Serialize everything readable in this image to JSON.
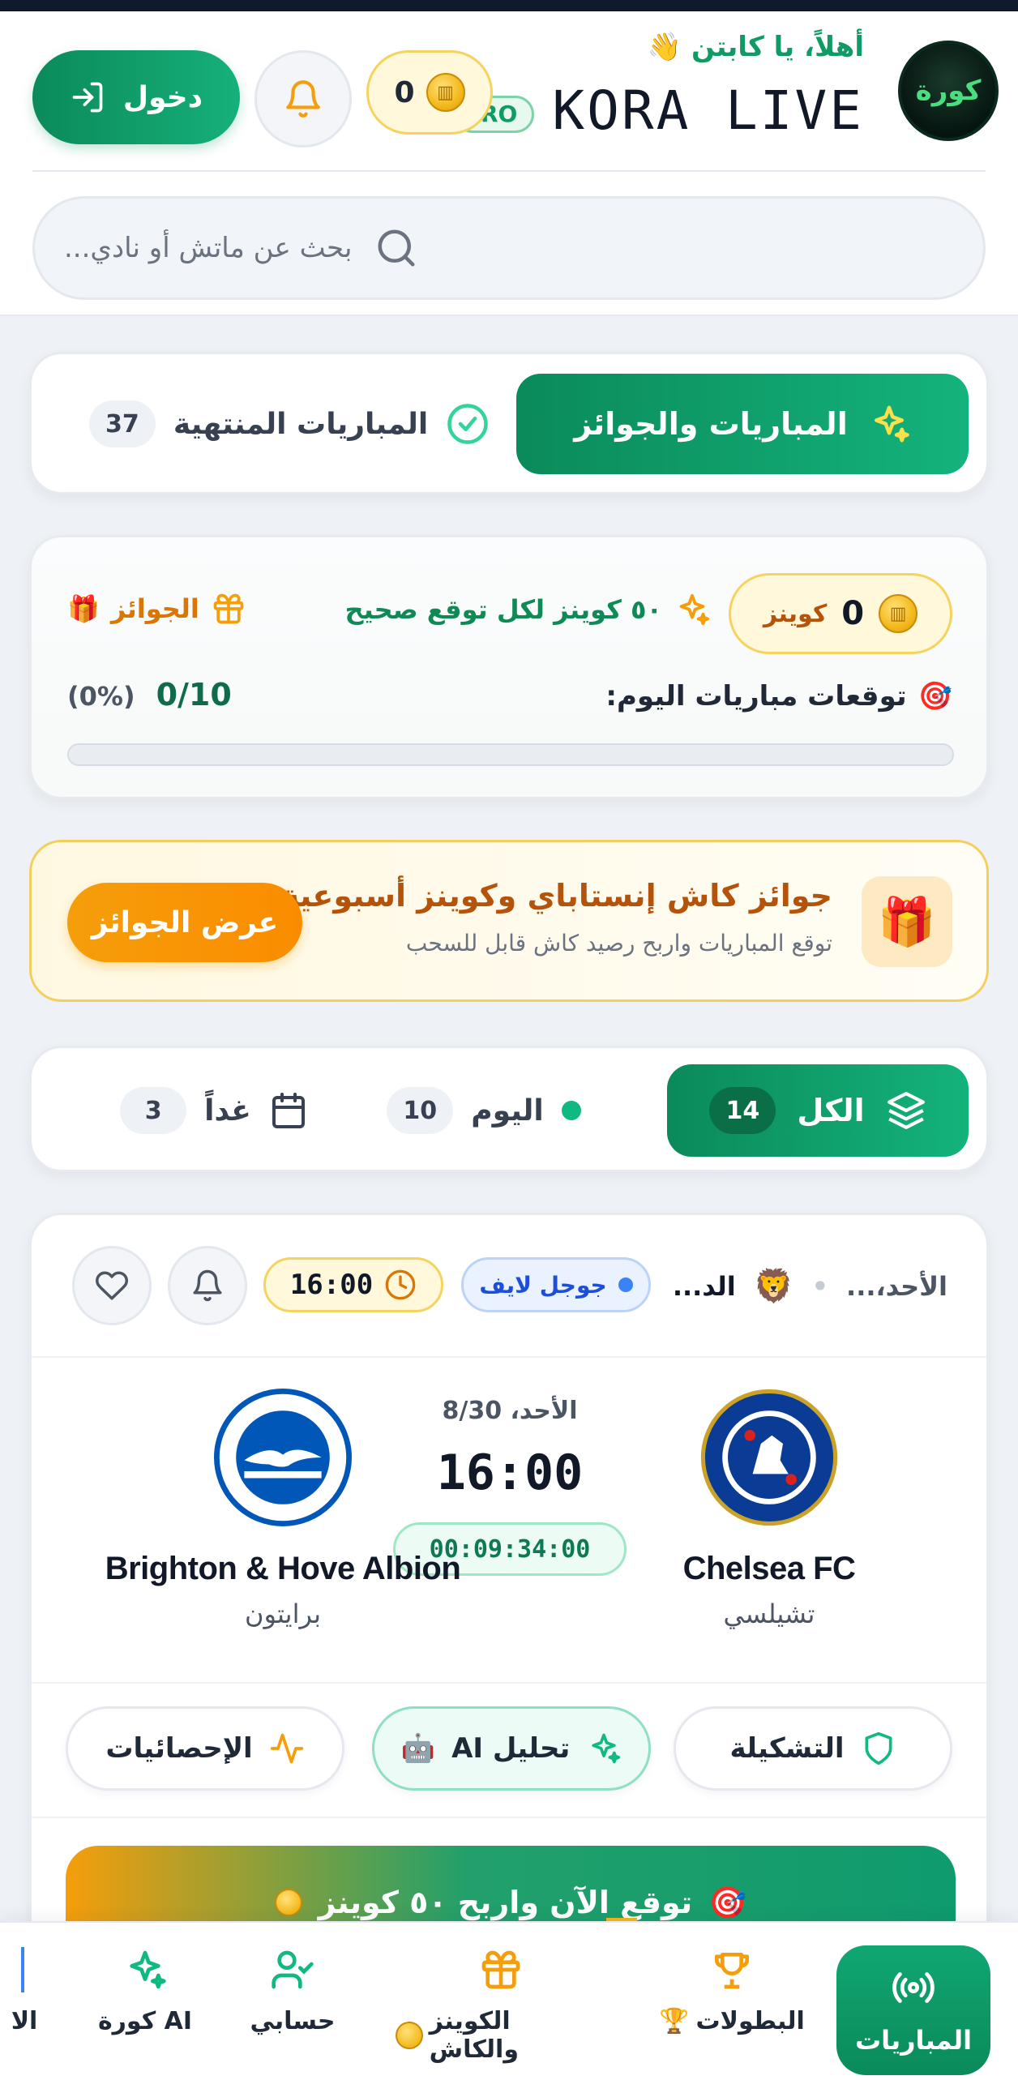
{
  "header": {
    "greeting": "أهلاً، يا كابتن",
    "wave_emoji": "👋",
    "brand": "KORA LIVE",
    "logo_text": "كورة",
    "pro_badge": "RO",
    "coins": "0",
    "login_label": "دخول"
  },
  "search": {
    "placeholder": "بحث عن ماتش أو نادي..."
  },
  "main_tabs": {
    "active_label": "المباريات والجوائز",
    "ended_label": "المباريات المنتهية",
    "ended_count": "37"
  },
  "predictions": {
    "coins_value": "0",
    "coins_label": "كوينز",
    "per_correct": "٥٠ كوينز لكل توقع صحيح",
    "prizes_label": "الجوائز",
    "today_label": "توقعات مباريات اليوم:",
    "ratio": "0/10",
    "percent": "(0%)",
    "progress": 0
  },
  "promo": {
    "title": "جوائز كاش إنستاباي وكوينز أسبوعية ...",
    "subtitle": "توقع المباريات واربح رصيد كاش قابل للسحب",
    "button": "عرض الجوائز"
  },
  "day_tabs": {
    "all_label": "الكل",
    "all_count": "14",
    "today_label": "اليوم",
    "today_count": "10",
    "tomorrow_label": "غداً",
    "tomorrow_count": "3"
  },
  "match": {
    "day_short": "الأحد،...",
    "league": "الد...",
    "channel": "جوجل لايف",
    "time": "16:00",
    "home_en": "Chelsea FC",
    "home_ar": "تشيلسي",
    "away_en": "Brighton & Hove Albion",
    "away_ar": "برايتون",
    "date": "الأحد، 8/30",
    "kickoff": "16:00",
    "countdown": "00:09:34:00",
    "actions": {
      "lineup": "التشكيلة",
      "ai": "تحليل AI",
      "stats": "الإحصائيات"
    },
    "cta": "توقع الآن واربح ٥٠ كوينز"
  },
  "bottom_nav": {
    "matches": "المباريات",
    "leagues": "البطولات",
    "coins_cash": "الكوينز والكاش",
    "account": "حسابي",
    "kora_ai": "كورة AI",
    "more": "الا"
  },
  "colors": {
    "primary": "#0b8a5a",
    "accent": "#f59e0b",
    "coin": "#f3b91b"
  }
}
